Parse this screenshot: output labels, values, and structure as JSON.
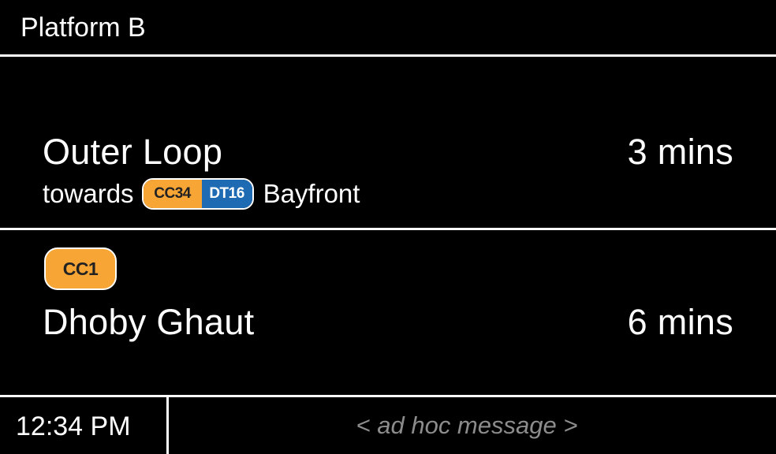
{
  "header": {
    "platform": "Platform B"
  },
  "departures": [
    {
      "destination": "Outer Loop",
      "time": "3 mins",
      "towards_label": "towards",
      "towards_badge": {
        "left_code": "CC34",
        "right_code": "DT16"
      },
      "towards_station": "Bayfront"
    },
    {
      "station_code": "CC1",
      "destination": "Dhoby Ghaut",
      "time": "6 mins"
    }
  ],
  "footer": {
    "clock": "12:34 PM",
    "message": "< ad hoc message >"
  },
  "colors": {
    "background": "#000000",
    "foreground": "#FFFFFF",
    "circle_line": "#F7A635",
    "downtown_line": "#1E6AB3",
    "message_text": "#8C8C8C"
  }
}
